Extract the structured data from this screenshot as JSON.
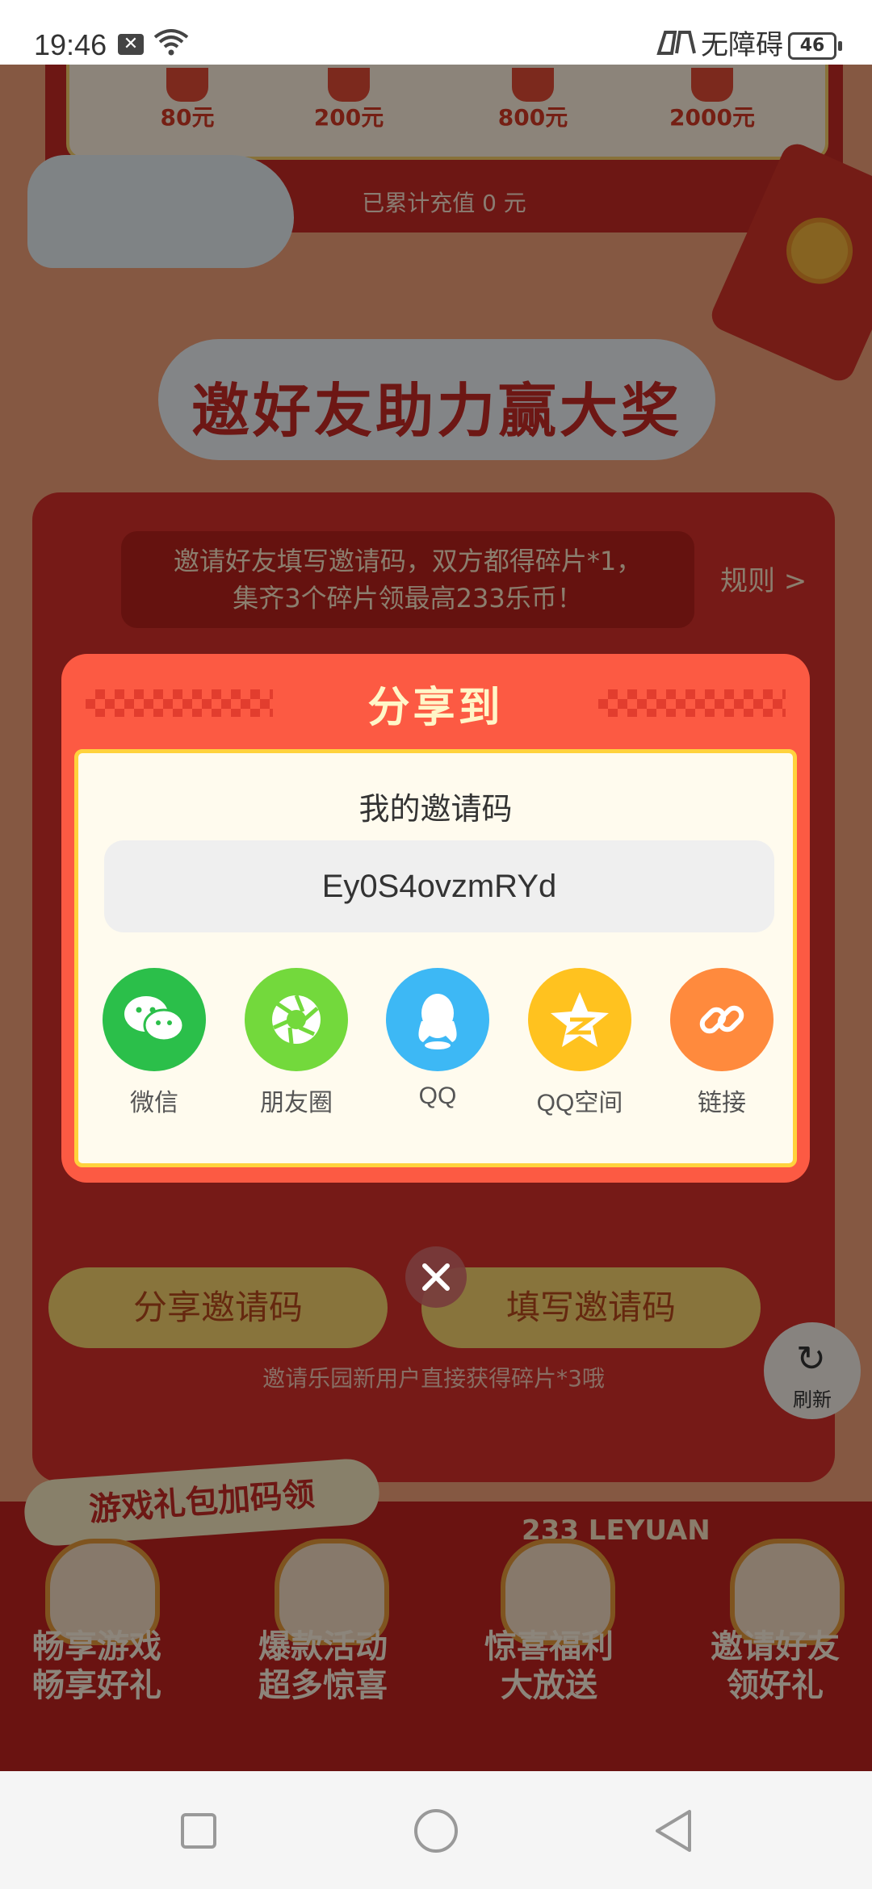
{
  "status_bar": {
    "time": "19:46",
    "accessibility_label": "无障碍",
    "battery": "46"
  },
  "background": {
    "recharge_tiers": [
      "80元",
      "200元",
      "800元",
      "2000元"
    ],
    "recharge_total": "已累计充值 0 元",
    "event_title": "邀好友助力赢大奖",
    "rule_text_line1": "邀请好友填写邀请码，双方都得碎片*1，",
    "rule_text_line2": "集齐3个碎片领最高233乐币！",
    "rules_link": "规则 >",
    "share_code_button": "分享邀请码",
    "enter_code_button": "填写邀请码",
    "new_user_note": "邀请乐园新用户直接获得碎片*3哦",
    "refresh_label": "刷新",
    "gift_tag": "游戏礼包加码领",
    "leyuan_label": "233 LEYUAN",
    "features": [
      {
        "line1": "畅享游戏",
        "line2": "畅享好礼"
      },
      {
        "line1": "爆款活动",
        "line2": "超多惊喜"
      },
      {
        "line1": "惊喜福利",
        "line2": "大放送"
      },
      {
        "line1": "邀请好友",
        "line2": "领好礼"
      }
    ]
  },
  "modal": {
    "title": "分享到",
    "code_label": "我的邀请码",
    "invite_code": "Ey0S4ovzmRYd",
    "share_targets": [
      {
        "label": "微信",
        "icon": "wechat-icon",
        "color": "#2bbf4a"
      },
      {
        "label": "朋友圈",
        "icon": "moments-icon",
        "color": "#73d93c"
      },
      {
        "label": "QQ",
        "icon": "qq-icon",
        "color": "#3db8f5"
      },
      {
        "label": "QQ空间",
        "icon": "qzone-icon",
        "color": "#ffc21f"
      },
      {
        "label": "链接",
        "icon": "link-icon",
        "color": "#ff8a3d"
      }
    ]
  }
}
